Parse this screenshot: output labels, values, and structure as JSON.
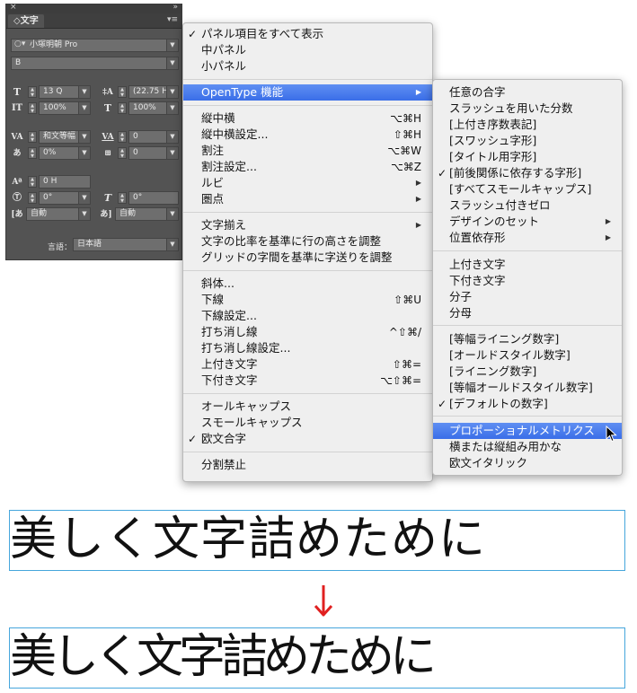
{
  "panel": {
    "close_icon": "×",
    "collapse_icon": "»",
    "tab": "◇文字",
    "menu_icon": "▾≡",
    "font_family": "小塚明朝 Pro",
    "font_style": "B",
    "font_size": "13 Q",
    "leading": "(22.75 H)",
    "vertical_scale": "100%",
    "horizontal_scale": "100%",
    "kerning": "和文等幅",
    "tracking": "0",
    "tsume": "0%",
    "tsume_right": "0",
    "baseline_shift": "0 H",
    "rotation": "0°",
    "skew": "0°",
    "aki_left": "自動",
    "aki_right": "自動",
    "language_label": "言語：",
    "language": "日本語"
  },
  "menu": {
    "items": [
      {
        "label": "パネル項目をすべて表示",
        "check": true
      },
      {
        "label": "中パネル"
      },
      {
        "label": "小パネル"
      },
      {
        "label": "OpenType 機能",
        "submenu": true,
        "highlight": true
      },
      {
        "label": "縦中横",
        "shortcut": "⌥⌘H"
      },
      {
        "label": "縦中横設定...",
        "shortcut": "⇧⌘H"
      },
      {
        "label": "割注",
        "shortcut": "⌥⌘W"
      },
      {
        "label": "割注設定...",
        "shortcut": "⌥⌘Z"
      },
      {
        "label": "ルビ",
        "submenu": true
      },
      {
        "label": "圏点",
        "submenu": true
      },
      {
        "label": "文字揃え",
        "submenu": true
      },
      {
        "label": "文字の比率を基準に行の高さを調整"
      },
      {
        "label": "グリッドの字間を基準に字送りを調整"
      },
      {
        "label": "斜体..."
      },
      {
        "label": "下線",
        "shortcut": "⇧⌘U"
      },
      {
        "label": "下線設定..."
      },
      {
        "label": "打ち消し線",
        "shortcut": "^⇧⌘/"
      },
      {
        "label": "打ち消し線設定..."
      },
      {
        "label": "上付き文字",
        "shortcut": "⇧⌘="
      },
      {
        "label": "下付き文字",
        "shortcut": "⌥⇧⌘="
      },
      {
        "label": "オールキャップス"
      },
      {
        "label": "スモールキャップス"
      },
      {
        "label": "欧文合字",
        "check": true
      },
      {
        "label": "分割禁止"
      }
    ]
  },
  "submenu": {
    "items": [
      {
        "label": "任意の合字"
      },
      {
        "label": "スラッシュを用いた分数"
      },
      {
        "label": "[上付き序数表記]"
      },
      {
        "label": "[スワッシュ字形]"
      },
      {
        "label": "[タイトル用字形]"
      },
      {
        "label": "[前後関係に依存する字形]",
        "check": true
      },
      {
        "label": "[すべてスモールキャップス]"
      },
      {
        "label": "スラッシュ付きゼロ"
      },
      {
        "label": "デザインのセット",
        "submenu": true
      },
      {
        "label": "位置依存形",
        "submenu": true
      },
      {
        "label": "上付き文字"
      },
      {
        "label": "下付き文字"
      },
      {
        "label": "分子"
      },
      {
        "label": "分母"
      },
      {
        "label": "[等幅ライニング数字]"
      },
      {
        "label": "[オールドスタイル数字]"
      },
      {
        "label": "[ライニング数字]"
      },
      {
        "label": "[等幅オールドスタイル数字]"
      },
      {
        "label": "[デフォルトの数字]",
        "check": true
      },
      {
        "label": "プロポーショナルメトリクス",
        "highlight": true
      },
      {
        "label": "横または縦組み用かな"
      },
      {
        "label": "欧文イタリック"
      }
    ]
  },
  "check_mark": "✓",
  "submenu_arrow": "▶",
  "demo": {
    "before": "美しく文字詰めために",
    "after": "美しく文字詰めために",
    "arrow_color": "#e02020"
  }
}
